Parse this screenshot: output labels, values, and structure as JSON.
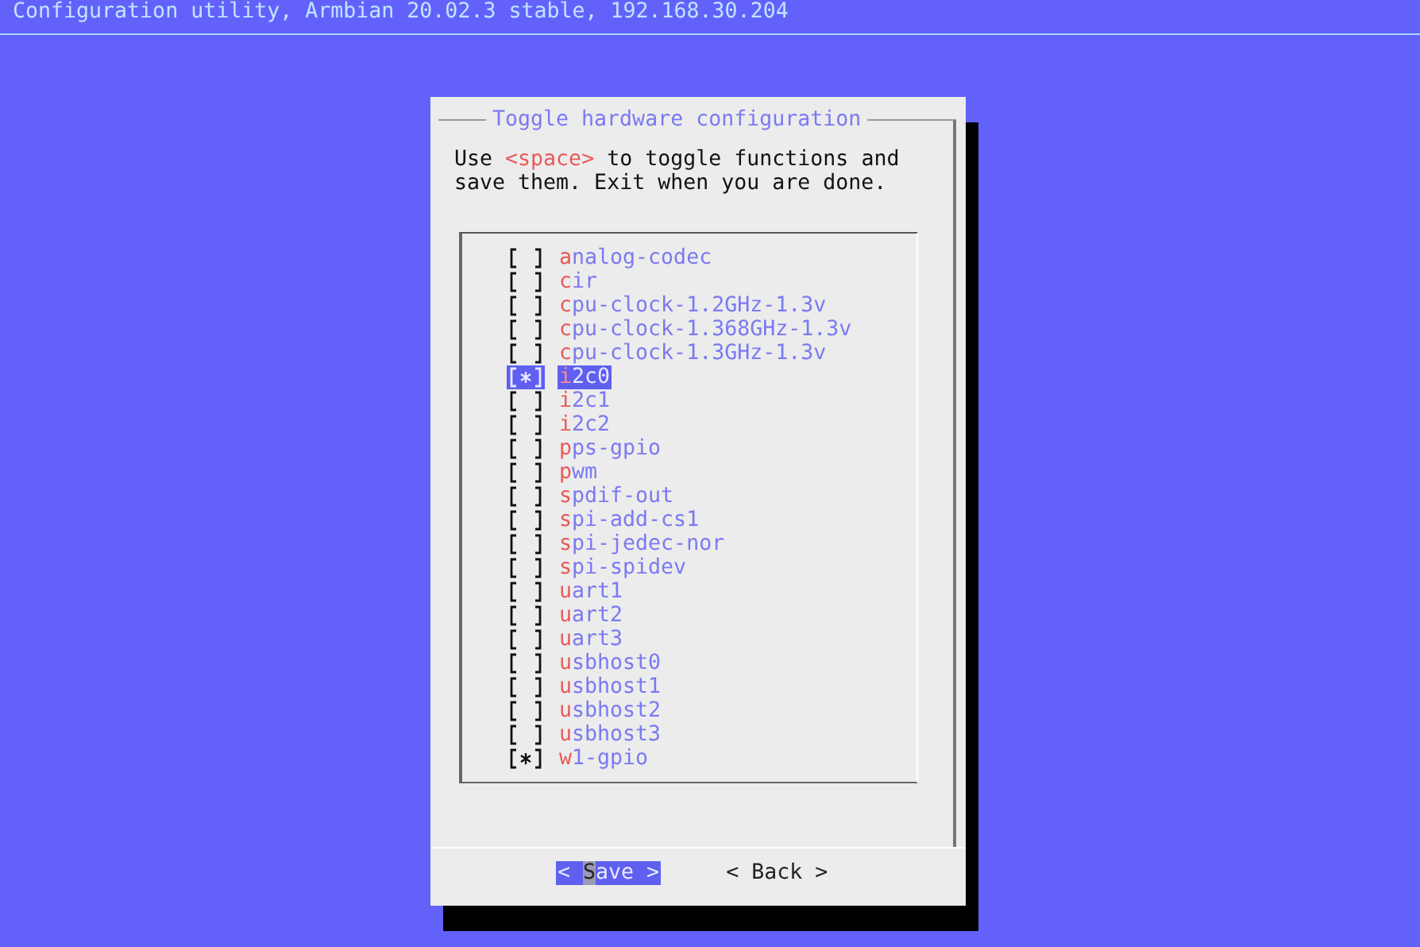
{
  "title_bar": {
    "text": "Configuration utility, Armbian 20.02.3 stable, 192.168.30.204"
  },
  "dialog": {
    "title": "Toggle hardware configuration",
    "message": {
      "before": "Use ",
      "key": "<space>",
      "after": " to toggle functions and save them. Exit when you are done."
    },
    "items": [
      {
        "label": "analog-codec",
        "checked": false,
        "selected": false
      },
      {
        "label": "cir",
        "checked": false,
        "selected": false
      },
      {
        "label": "cpu-clock-1.2GHz-1.3v",
        "checked": false,
        "selected": false
      },
      {
        "label": "cpu-clock-1.368GHz-1.3v",
        "checked": false,
        "selected": false
      },
      {
        "label": "cpu-clock-1.3GHz-1.3v",
        "checked": false,
        "selected": false
      },
      {
        "label": "i2c0",
        "checked": true,
        "selected": true
      },
      {
        "label": "i2c1",
        "checked": false,
        "selected": false
      },
      {
        "label": "i2c2",
        "checked": false,
        "selected": false
      },
      {
        "label": "pps-gpio",
        "checked": false,
        "selected": false
      },
      {
        "label": "pwm",
        "checked": false,
        "selected": false
      },
      {
        "label": "spdif-out",
        "checked": false,
        "selected": false
      },
      {
        "label": "spi-add-cs1",
        "checked": false,
        "selected": false
      },
      {
        "label": "spi-jedec-nor",
        "checked": false,
        "selected": false
      },
      {
        "label": "spi-spidev",
        "checked": false,
        "selected": false
      },
      {
        "label": "uart1",
        "checked": false,
        "selected": false
      },
      {
        "label": "uart2",
        "checked": false,
        "selected": false
      },
      {
        "label": "uart3",
        "checked": false,
        "selected": false
      },
      {
        "label": "usbhost0",
        "checked": false,
        "selected": false
      },
      {
        "label": "usbhost1",
        "checked": false,
        "selected": false
      },
      {
        "label": "usbhost2",
        "checked": false,
        "selected": false
      },
      {
        "label": "usbhost3",
        "checked": false,
        "selected": false
      },
      {
        "label": "w1-gpio",
        "checked": true,
        "selected": false
      }
    ],
    "buttons": [
      {
        "label": "< Save >",
        "selected": true
      },
      {
        "label": "< Back >",
        "selected": false
      }
    ]
  }
}
